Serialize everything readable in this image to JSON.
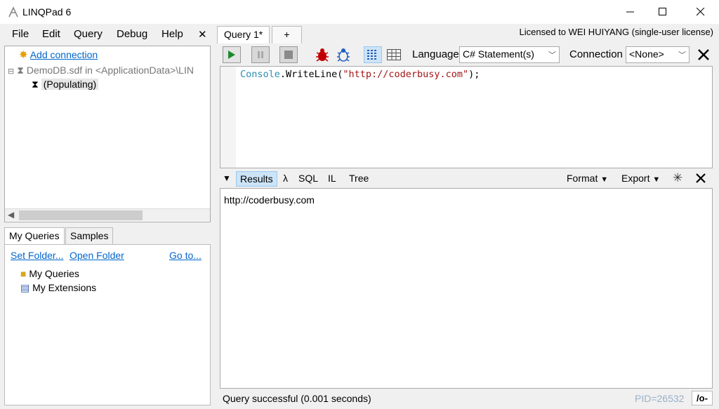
{
  "window": {
    "title": "LINQPad 6"
  },
  "menu": [
    "File",
    "Edit",
    "Query",
    "Debug",
    "Help"
  ],
  "menu_close": "✕",
  "connections": {
    "add_label": "Add connection",
    "db_label": "DemoDB.sdf in <ApplicationData>\\LIN",
    "populating_label": "(Populating)"
  },
  "query_panel": {
    "tabs": [
      "My Queries",
      "Samples"
    ],
    "set_folder": "Set Folder...",
    "open_folder": "Open Folder",
    "goto": "Go to...",
    "items": [
      "My Queries",
      "My Extensions"
    ]
  },
  "query_tabs": {
    "active": "Query 1*",
    "add": "+"
  },
  "license": "Licensed to WEI HUIYANG (single-user license)",
  "toolbar": {
    "language_label": "Language",
    "language_value": "C# Statement(s)",
    "connection_label": "Connection",
    "connection_value": "<None>"
  },
  "editor": {
    "code_obj": "Console",
    "code_dot": ".",
    "code_method": "WriteLine",
    "code_open": "(",
    "code_str": "\"http://coderbusy.com\"",
    "code_close": ");"
  },
  "results_bar": {
    "tabs": [
      "Results",
      "λ",
      "SQL",
      "IL",
      "Tree"
    ],
    "format": "Format",
    "export": "Export"
  },
  "results": {
    "output": "http://coderbusy.com"
  },
  "status": {
    "message": "Query successful  (0.001 seconds)",
    "pid": "PID=26532",
    "toggle": "/o-"
  },
  "colors": {
    "link": "#0066cc",
    "code_type": "#2b91af",
    "code_string": "#a31515",
    "run_green": "#1b8a2f",
    "bug_red": "#c00000",
    "bug_blue": "#2060c0"
  }
}
